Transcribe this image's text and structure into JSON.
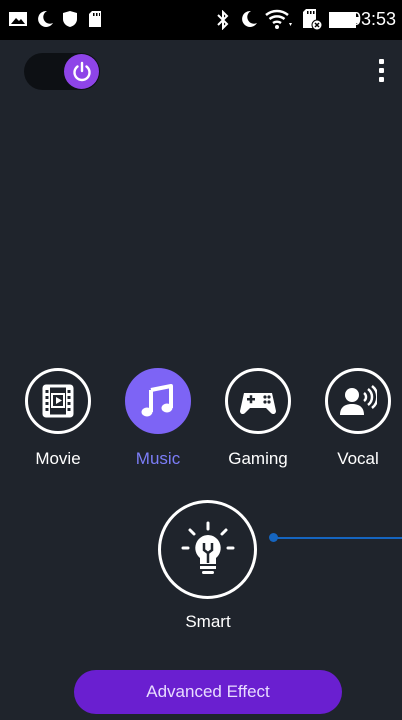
{
  "status_bar": {
    "time": "03:53",
    "left_icons": [
      "image-icon",
      "moon-icon",
      "shield-icon",
      "sd-card-icon"
    ],
    "right_icons": [
      "bluetooth-icon",
      "moon-icon",
      "wifi-icon",
      "sim-icon",
      "battery-icon"
    ]
  },
  "power_toggle": {
    "state": "on",
    "color": "#8e44e8"
  },
  "modes": [
    {
      "label": "Movie",
      "icon": "film-icon",
      "active": false
    },
    {
      "label": "Music",
      "icon": "music-note-icon",
      "active": true
    },
    {
      "label": "Gaming",
      "icon": "gamepad-icon",
      "active": false
    },
    {
      "label": "Vocal",
      "icon": "speaker-voice-icon",
      "active": false
    }
  ],
  "smart": {
    "label": "Smart",
    "icon": "lightbulb-icon"
  },
  "advanced_button": {
    "label": "Advanced Effect",
    "color": "#6a1fd0"
  },
  "colors": {
    "background": "#1f242c",
    "accent": "#7d64f5",
    "line": "#1565c0"
  }
}
